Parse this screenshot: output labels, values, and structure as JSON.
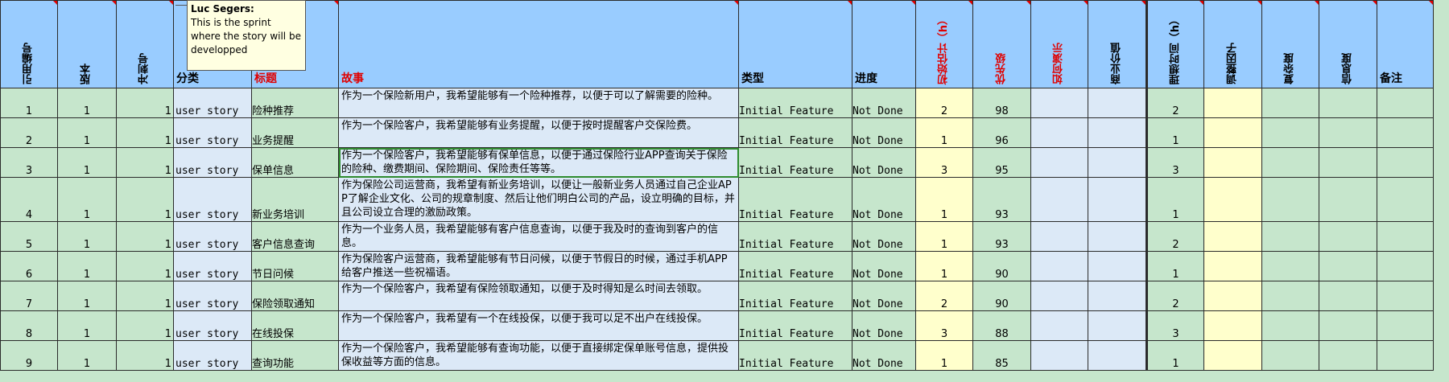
{
  "headers": [
    {
      "key": "ref_no",
      "label": "引用编号",
      "vertical": true,
      "red": false
    },
    {
      "key": "version",
      "label": "版本",
      "vertical": true,
      "red": false
    },
    {
      "key": "sprint",
      "label": "冲刺号",
      "vertical": true,
      "red": false
    },
    {
      "key": "category",
      "label": "分类",
      "vertical": false,
      "red": false
    },
    {
      "key": "title",
      "label": "标题",
      "vertical": false,
      "red": true
    },
    {
      "key": "story",
      "label": "故事",
      "vertical": false,
      "red": true
    },
    {
      "key": "type",
      "label": "类型",
      "vertical": false,
      "red": false
    },
    {
      "key": "progress",
      "label": "进度",
      "vertical": false,
      "red": false
    },
    {
      "key": "initial_estimate",
      "label": "初始估计（h）",
      "vertical": true,
      "red": true
    },
    {
      "key": "priority",
      "label": "优先级",
      "vertical": true,
      "red": true
    },
    {
      "key": "demo",
      "label": "如何演示",
      "vertical": true,
      "red": true
    },
    {
      "key": "business_value",
      "label": "商业价值",
      "vertical": true,
      "red": false
    },
    {
      "key": "ideal_time",
      "label": "理想时间（h）",
      "vertical": true,
      "red": false
    },
    {
      "key": "adjust_factor",
      "label": "调整因子",
      "vertical": true,
      "red": false
    },
    {
      "key": "complexity",
      "label": "复杂度",
      "vertical": true,
      "red": false
    },
    {
      "key": "confidence",
      "label": "信息度",
      "vertical": true,
      "red": false
    },
    {
      "key": "notes",
      "label": "备注",
      "vertical": false,
      "red": false
    }
  ],
  "comment": {
    "author": "Luc Segers:",
    "text": "This is the sprint\nwhere the story will be\ndevelopped"
  },
  "rows": [
    {
      "ref": "1",
      "ver": "1",
      "sprint": "1",
      "cat": "user story",
      "title": "险种推荐",
      "story": "作为一个保险新用户，我希望能够有一个险种推荐，以便于可以了解需要的险种。",
      "type": "Initial Feature",
      "progress": "Not Done",
      "est": "2",
      "prio": "98",
      "ideal": "2",
      "tall": false
    },
    {
      "ref": "2",
      "ver": "1",
      "sprint": "1",
      "cat": "user story",
      "title": "业务提醒",
      "story": "作为一个保险客户，我希望能够有业务提醒，以便于按时提醒客户交保险费。",
      "type": "Initial Feature",
      "progress": "Not Done",
      "est": "1",
      "prio": "96",
      "ideal": "1",
      "tall": false
    },
    {
      "ref": "3",
      "ver": "1",
      "sprint": "1",
      "cat": "user story",
      "title": "保单信息",
      "story": "作为一个保险客户，我希望能够有保单信息，以便于通过保险行业APP查询关于保险的险种、缴费期间、保险期间、保险责任等等。",
      "type": "Initial Feature",
      "progress": "Not Done",
      "est": "3",
      "prio": "95",
      "ideal": "3",
      "tall": false
    },
    {
      "ref": "4",
      "ver": "1",
      "sprint": "1",
      "cat": "user story",
      "title": "新业务培训",
      "story": "作为保险公司运营商，我希望有新业务培训，以便让一般新业务人员通过自己企业APP了解企业文化、公司的规章制度、然后让他们明白公司的产品，设立明确的目标，并且公司设立合理的激励政策。",
      "type": "Initial Feature",
      "progress": "Not Done",
      "est": "1",
      "prio": "93",
      "ideal": "1",
      "tall": true
    },
    {
      "ref": "5",
      "ver": "1",
      "sprint": "1",
      "cat": "user story",
      "title": "客户信息查询",
      "story": "作为一个业务人员，我希望能够有客户信息查询，以便于我及时的查询到客户的信息。",
      "type": "Initial Feature",
      "progress": "Not Done",
      "est": "1",
      "prio": "93",
      "ideal": "2",
      "tall": false
    },
    {
      "ref": "6",
      "ver": "1",
      "sprint": "1",
      "cat": "user story",
      "title": "节日问候",
      "story": "作为保险客户运营商，我希望能够有节日问候，以便于节假日的时候，通过手机APP给客户推送一些祝福语。",
      "type": "Initial Feature",
      "progress": "Not Done",
      "est": "1",
      "prio": "90",
      "ideal": "1",
      "tall": false
    },
    {
      "ref": "7",
      "ver": "1",
      "sprint": "1",
      "cat": "user story",
      "title": "保险领取通知",
      "story": "作为一个保险客户，我希望有保险领取通知，以便于及时得知是么时间去领取。",
      "type": "Initial Feature",
      "progress": "Not Done",
      "est": "2",
      "prio": "90",
      "ideal": "2",
      "tall": false
    },
    {
      "ref": "8",
      "ver": "1",
      "sprint": "1",
      "cat": "user story",
      "title": "在线投保",
      "story": "作为一个保险客户，我希望有一个在线投保，以便于我可以足不出户在线投保。",
      "type": "Initial Feature",
      "progress": "Not Done",
      "est": "3",
      "prio": "88",
      "ideal": "3",
      "tall": false
    },
    {
      "ref": "9",
      "ver": "1",
      "sprint": "1",
      "cat": "user story",
      "title": "查询功能",
      "story": "作为一个保险客户，我希望能够有查询功能，以便于直接绑定保单账号信息，提供投保收益等方面的信息。",
      "type": "Initial Feature",
      "progress": "Not Done",
      "est": "1",
      "prio": "85",
      "ideal": "1",
      "tall": false
    }
  ],
  "selected_row": 2
}
